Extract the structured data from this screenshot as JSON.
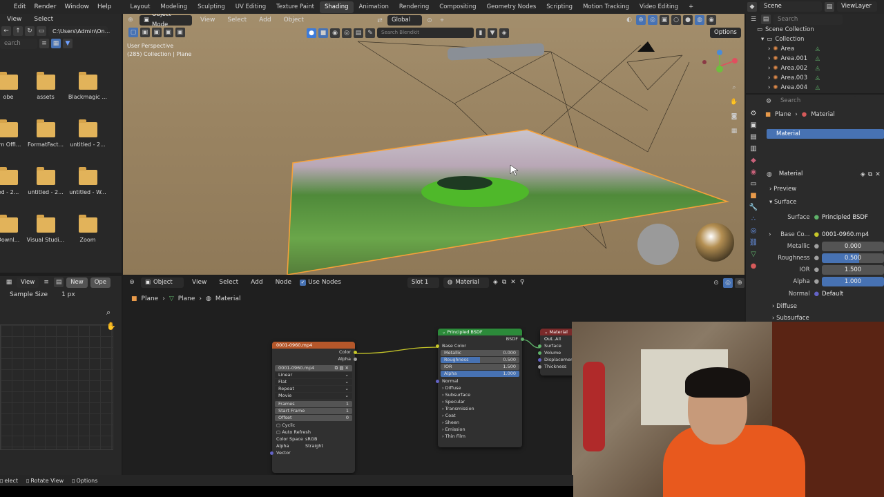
{
  "topbar": {
    "menus": [
      "View",
      "Select"
    ],
    "left_menus": [
      "Edit",
      "Window",
      "Render",
      "Help"
    ],
    "workspaces": [
      "Layout",
      "Modeling",
      "Sculpting",
      "UV Editing",
      "Texture Paint",
      "Shading",
      "Animation",
      "Rendering",
      "Compositing",
      "Geometry Nodes",
      "Scripting",
      "Motion Tracking",
      "Video Editing"
    ],
    "active_workspace": "Shading",
    "add_tab": "+",
    "scene": "Scene",
    "view_layer": "ViewLayer"
  },
  "file_browser": {
    "path": "C:\\Users\\Admin\\On...",
    "search_placeholder": "earch",
    "folders": [
      {
        "label": "obe"
      },
      {
        "label": "assets"
      },
      {
        "label": "Blackmagic ..."
      },
      {
        "label": "om Offi..."
      },
      {
        "label": "FormatFact..."
      },
      {
        "label": "untitled - 2..."
      },
      {
        "label": "ed - 2..."
      },
      {
        "label": "untitled - 2..."
      },
      {
        "label": "untitled - W..."
      },
      {
        "label": "Downl..."
      },
      {
        "label": "Visual Studi..."
      },
      {
        "label": "Zoom"
      }
    ]
  },
  "viewport": {
    "mode": "Object Mode",
    "menus": [
      "View",
      "Select",
      "Add",
      "Object"
    ],
    "transform": "Global",
    "search_placeholder": "Search Blendkit",
    "options": "Options",
    "info_line1": "User Perspective",
    "info_line2": "(285) Collection | Plane"
  },
  "outliner": {
    "search_placeholder": "Search",
    "root": "Scene Collection",
    "collection": "Collection",
    "items": [
      "Area",
      "Area.001",
      "Area.002",
      "Area.003",
      "Area.004"
    ]
  },
  "properties": {
    "search_placeholder": "Search",
    "breadcrumb": [
      "Plane",
      "Material"
    ],
    "slot": "Material",
    "material_name": "Material",
    "sections": {
      "preview": "Preview",
      "surface": "Surface",
      "diffuse": "Diffuse",
      "subsurface": "Subsurface"
    },
    "surface_label": "Surface",
    "surface_value": "Principled BSDF",
    "base_color_label": "Base Co...",
    "base_color_value": "0001-0960.mp4",
    "metallic_label": "Metallic",
    "metallic_value": "0.000",
    "roughness_label": "Roughness",
    "roughness_value": "0.500",
    "roughness_fill": 0.5,
    "ior_label": "IOR",
    "ior_value": "1.500",
    "alpha_label": "Alpha",
    "alpha_value": "1.000",
    "normal_label": "Normal",
    "normal_value": "Default"
  },
  "left_panel": {
    "view": "View",
    "new": "New",
    "open": "Ope",
    "sample_label": "Sample Size",
    "sample_value": "1 px"
  },
  "node_editor": {
    "object": "Object",
    "menus": [
      "View",
      "Select",
      "Add",
      "Node"
    ],
    "use_nodes": "Use Nodes",
    "slot": "Slot 1",
    "material": "Material",
    "breadcrumb": [
      "Plane",
      "Plane",
      "Material"
    ],
    "image_node": {
      "title": "0001-0960.mp4",
      "out_color": "Color",
      "out_alpha": "Alpha",
      "image": "0001-0960.mp4",
      "interp": "Linear",
      "proj": "Flat",
      "ext": "Repeat",
      "source": "Movie",
      "frames_label": "Frames",
      "frames_value": "1",
      "start_label": "Start Frame",
      "start_value": "1",
      "offset_label": "Offset",
      "offset_value": "0",
      "cyclic": "Cyclic",
      "auto_refresh": "Auto Refresh",
      "cs_label": "Color Space",
      "cs_value": "sRGB",
      "alpha_label": "Alpha",
      "alpha_value": "Straight",
      "vector": "Vector"
    },
    "bsdf_node": {
      "title": "Principled BSDF",
      "out": "BSDF",
      "base_color": "Base Color",
      "metallic": "Metallic",
      "metallic_v": "0.000",
      "roughness": "Roughness",
      "roughness_v": "0.500",
      "ior": "IOR",
      "ior_v": "1.500",
      "alpha": "Alpha",
      "alpha_v": "1.000",
      "normal": "Normal",
      "panels": [
        "Diffuse",
        "Subsurface",
        "Specular",
        "Transmission",
        "Coat",
        "Sheen",
        "Emission",
        "Thin Film"
      ]
    },
    "output_node": {
      "title": "Material Out...",
      "target": "All",
      "inputs": [
        "Surface",
        "Volume",
        "Displacement",
        "Thickness"
      ]
    }
  },
  "statusbar": {
    "items": [
      "elect",
      "Rotate View",
      "Options"
    ]
  },
  "colors": {
    "accent_blue": "#4772b3",
    "selection_orange": "#f5a13a",
    "folder": "#e2b35a",
    "shader_green": "#2c8a3a",
    "texture_orange": "#b5572a"
  }
}
